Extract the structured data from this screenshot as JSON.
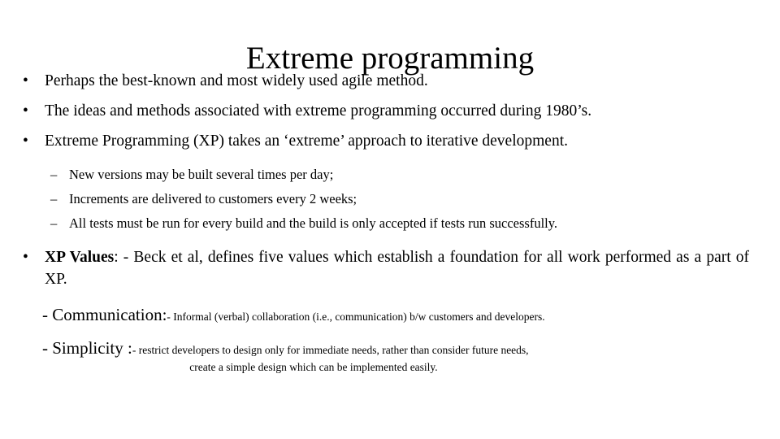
{
  "slide": {
    "title": "Extreme programming",
    "bullet_glyph": "•",
    "dash_glyph": "–",
    "bullets": [
      {
        "text": "Perhaps the best-known and most widely used agile method."
      },
      {
        "text": "The ideas and methods associated with extreme programming occurred during 1980’s."
      },
      {
        "text": "Extreme Programming (XP) takes an ‘extreme’ approach to iterative development."
      }
    ],
    "sub_bullets": [
      "New versions may be built several times per day;",
      "Increments are delivered to customers every 2 weeks;",
      "All tests must be run for every build and the build is only accepted if tests run successfully."
    ],
    "xp_values": {
      "label_bold": "XP  Values",
      "rest": ": - Beck et al, defines five values which establish a foundation for all work performed as a part of XP."
    },
    "values": [
      {
        "head": "- Communication:",
        "body": "- Informal (verbal) collaboration (i.e., communication) b/w customers and developers."
      },
      {
        "head": "- Simplicity :",
        "body": "- restrict developers to design only for immediate needs, rather than consider future needs,",
        "body_centered": "create a simple design which can be implemented easily."
      }
    ]
  },
  "colors": {
    "background": "#ffffff",
    "text": "#000000"
  }
}
